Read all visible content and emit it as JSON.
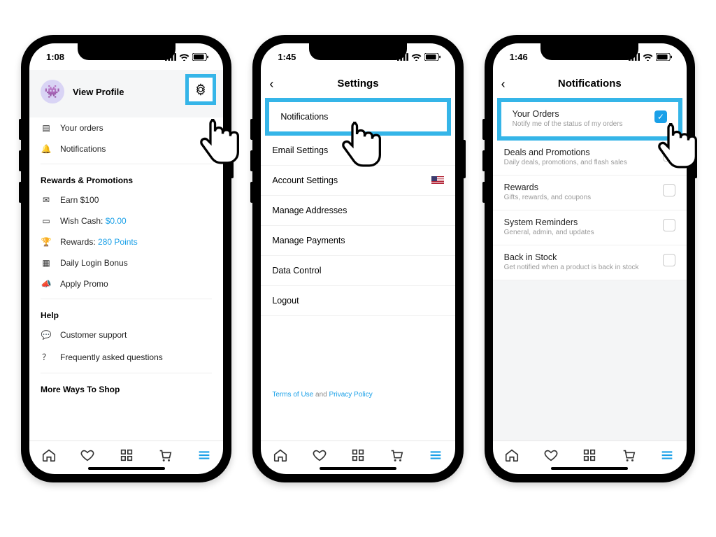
{
  "status": {
    "t1": "1:08",
    "t2": "1:45",
    "t3": "1:46"
  },
  "screen1": {
    "profile": "View Profile",
    "orders": "Your orders",
    "notifications": "Notifications",
    "rewards_header": "Rewards & Promotions",
    "earn": "Earn $100",
    "wish_cash_label": "Wish Cash: ",
    "wish_cash_value": "$0.00",
    "rewards_label": "Rewards: ",
    "rewards_value": "280 Points",
    "daily_login": "Daily Login Bonus",
    "apply_promo": "Apply Promo",
    "help_header": "Help",
    "support": "Customer support",
    "faq": "Frequently asked questions",
    "more_header": "More Ways To Shop"
  },
  "screen2": {
    "title": "Settings",
    "items": {
      "notifications": "Notifications",
      "email": "Email Settings",
      "account": "Account Settings",
      "addresses": "Manage Addresses",
      "payments": "Manage Payments",
      "data": "Data Control",
      "logout": "Logout"
    },
    "legal": {
      "terms": "Terms of Use",
      "and": " and ",
      "privacy": "Privacy Policy"
    }
  },
  "screen3": {
    "title": "Notifications",
    "items": [
      {
        "t": "Your Orders",
        "s": "Notify me of the status of my orders",
        "on": true
      },
      {
        "t": "Deals and Promotions",
        "s": "Daily deals, promotions, and flash sales",
        "on": false
      },
      {
        "t": "Rewards",
        "s": "Gifts, rewards, and coupons",
        "on": false
      },
      {
        "t": "System Reminders",
        "s": "General, admin, and updates",
        "on": false
      },
      {
        "t": "Back in Stock",
        "s": "Get notified when a product is back in stock",
        "on": false
      }
    ]
  }
}
